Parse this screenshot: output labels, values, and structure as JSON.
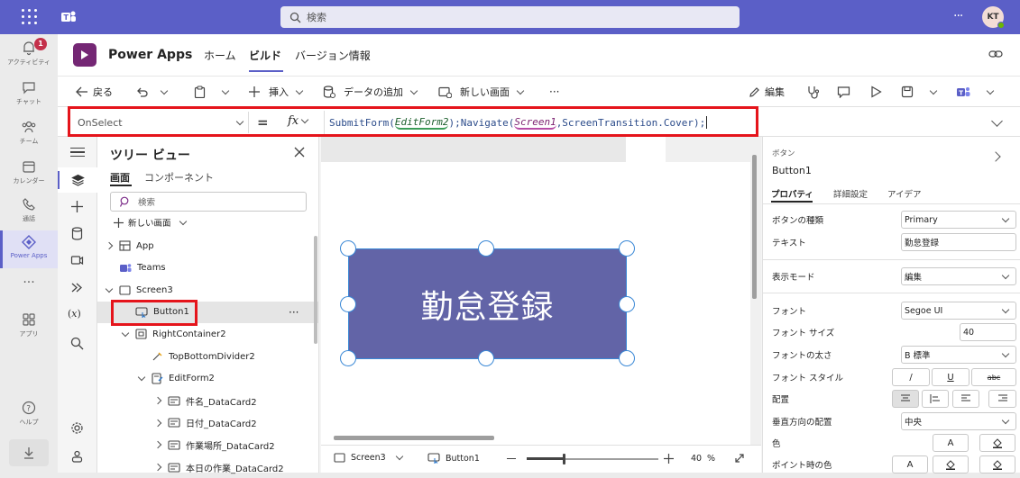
{
  "teams": {
    "search_placeholder": "検索",
    "user_initials": "KT",
    "more": "···"
  },
  "rail": [
    {
      "label": "アクティビティ",
      "badge": "1",
      "icon": "bell-icon"
    },
    {
      "label": "チャット",
      "icon": "chat-icon"
    },
    {
      "label": "チーム",
      "icon": "teams-icon"
    },
    {
      "label": "カレンダー",
      "icon": "calendar-icon"
    },
    {
      "label": "通話",
      "icon": "phone-icon"
    },
    {
      "label": "Power Apps",
      "icon": "powerapps-icon"
    },
    {
      "label": "···",
      "icon": "more-icon"
    },
    {
      "label": "アプリ",
      "icon": "apps-icon"
    },
    {
      "label": "ヘルプ",
      "icon": "help-icon"
    }
  ],
  "app": {
    "title": "Power Apps",
    "tabs": [
      "ホーム",
      "ビルド",
      "バージョン情報"
    ],
    "active_tab": "ビルド"
  },
  "toolbar": {
    "back": "戻る",
    "insert": "挿入",
    "add_data": "データの追加",
    "new_screen": "新しい画面",
    "more": "···",
    "edit": "編集"
  },
  "formula": {
    "property": "OnSelect",
    "equals": "=",
    "fx": "fx",
    "func1": "SubmitForm(",
    "arg1": "EditForm2",
    "sep1": ");Navigate(",
    "arg2": "Screen1",
    "rest": ",ScreenTransition.Cover);"
  },
  "tree": {
    "title": "ツリー ビュー",
    "tab_screens": "画面",
    "tab_components": "コンポーネント",
    "search_placeholder": "検索",
    "new_screen": "新しい画面",
    "items": [
      {
        "label": "App",
        "indent": 0,
        "icon": "app-icon",
        "expander": true
      },
      {
        "label": "Teams",
        "indent": 0,
        "icon": "teams-icon",
        "expander": false
      },
      {
        "label": "Screen3",
        "indent": 0,
        "icon": "screen-icon",
        "expander": true
      },
      {
        "label": "Button1",
        "indent": 1,
        "icon": "button-icon",
        "expander": false
      },
      {
        "label": "RightContainer2",
        "indent": 1,
        "icon": "container-icon",
        "expander": true
      },
      {
        "label": "TopBottomDivider2",
        "indent": 2,
        "icon": "divider-icon",
        "expander": false
      },
      {
        "label": "EditForm2",
        "indent": 2,
        "icon": "form-icon",
        "expander": true
      },
      {
        "label": "件名_DataCard2",
        "indent": 3,
        "icon": "card-icon",
        "expander": true
      },
      {
        "label": "日付_DataCard2",
        "indent": 3,
        "icon": "card-icon",
        "expander": true
      },
      {
        "label": "作業場所_DataCard2",
        "indent": 3,
        "icon": "card-icon",
        "expander": true
      },
      {
        "label": "本日の作業_DataCard2",
        "indent": 3,
        "icon": "card-icon",
        "expander": true
      }
    ],
    "row_more": "···"
  },
  "canvas": {
    "button_text": "勤怠登録",
    "button_color": "#6264a7"
  },
  "statusbar": {
    "screen": "Screen3",
    "control": "Button1",
    "zoom": "40",
    "zoom_unit": "%"
  },
  "props": {
    "type_label": "ボタン",
    "control_name": "Button1",
    "tabs": [
      "プロパティ",
      "詳細設定",
      "アイデア"
    ],
    "rows": {
      "button_kind_label": "ボタンの種類",
      "button_kind_value": "Primary",
      "text_label": "テキスト",
      "text_value": "勤怠登録",
      "display_mode_label": "表示モード",
      "display_mode_value": "編集",
      "font_label": "フォント",
      "font_value": "Segoe UI",
      "font_size_label": "フォント サイズ",
      "font_size_value": "40",
      "font_weight_label": "フォントの太さ",
      "font_weight_value": "B  標準",
      "font_style_label": "フォント スタイル",
      "align_label": "配置",
      "valign_label": "垂直方向の配置",
      "valign_value": "中央",
      "color_label": "色",
      "hover_color_label": "ポイント時の色",
      "style_italic": "/",
      "style_underline": "U",
      "style_strike": "abc",
      "color_a": "A"
    }
  }
}
